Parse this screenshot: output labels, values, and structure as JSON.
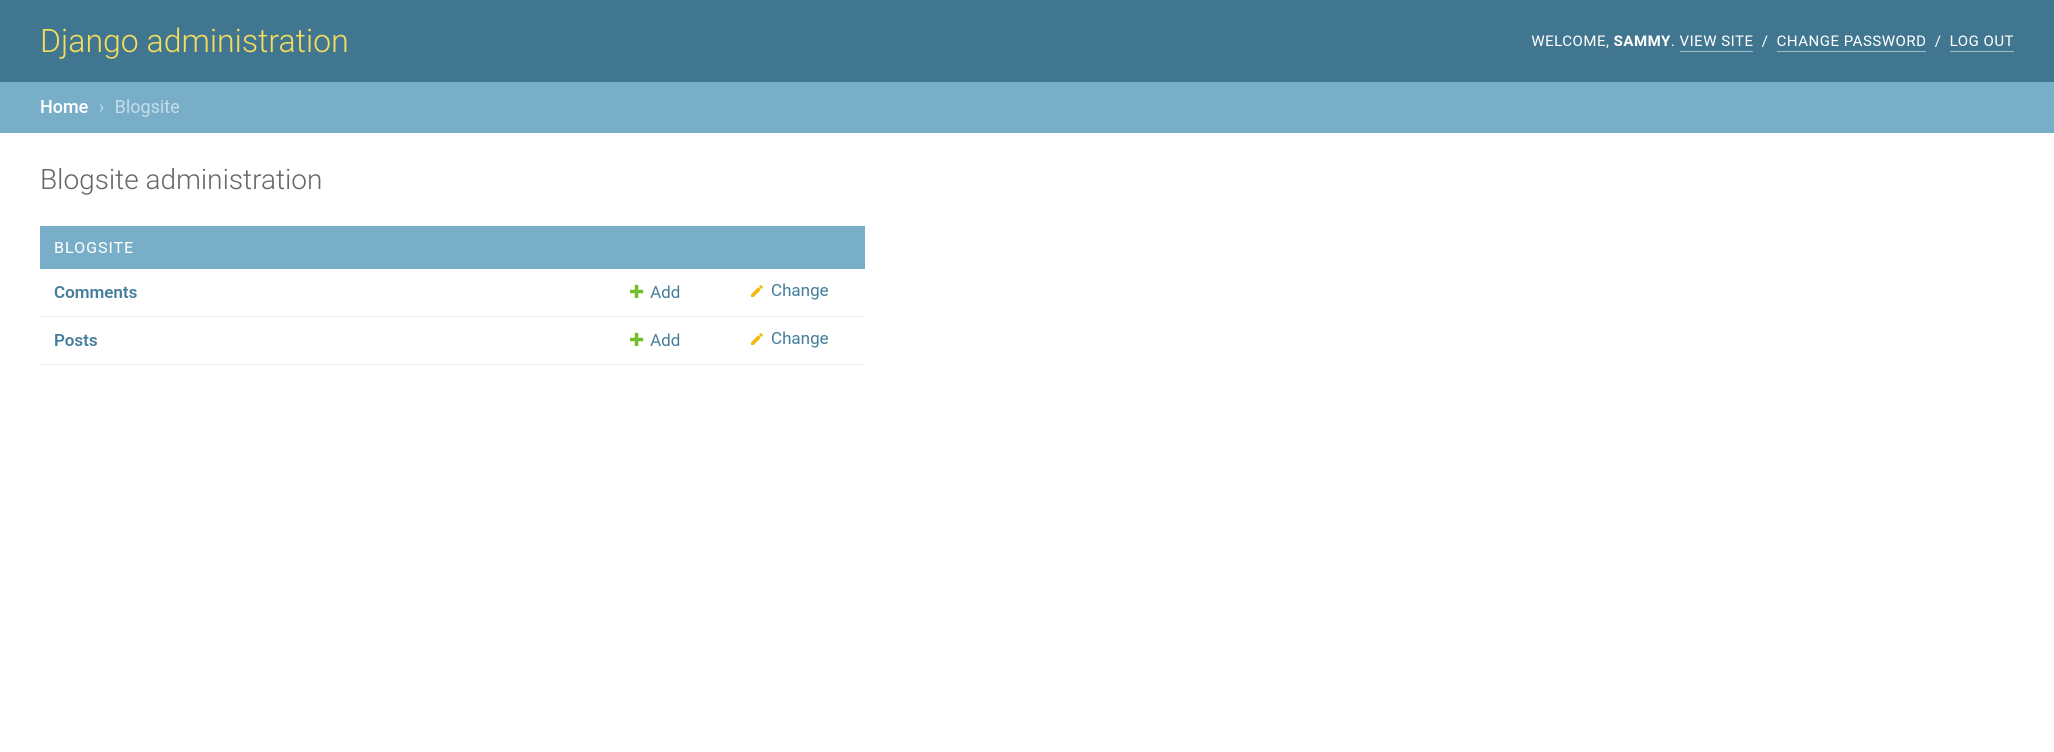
{
  "header": {
    "site_title": "Django administration",
    "user_tools": {
      "welcome": "WELCOME,",
      "username": "SAMMY",
      "period": ".",
      "view_site": "VIEW SITE",
      "change_password": "CHANGE PASSWORD",
      "log_out": "LOG OUT",
      "separator": "/"
    }
  },
  "breadcrumbs": {
    "home": "Home",
    "sep": "›",
    "current": "Blogsite"
  },
  "content": {
    "title": "Blogsite administration",
    "module": {
      "caption": "BLOGSITE",
      "models": [
        {
          "name": "Comments",
          "add_label": "Add",
          "change_label": "Change"
        },
        {
          "name": "Posts",
          "add_label": "Add",
          "change_label": "Change"
        }
      ]
    }
  }
}
